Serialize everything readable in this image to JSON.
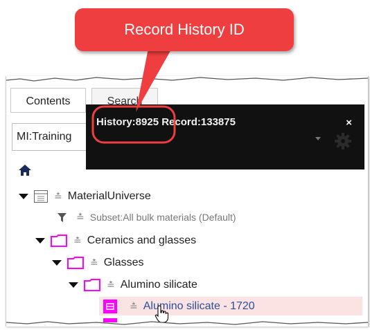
{
  "callout": {
    "text": "Record History ID",
    "color": "#ee3e3f"
  },
  "tabs": [
    {
      "label": "Contents",
      "active": true
    },
    {
      "label": "Search",
      "active": false
    }
  ],
  "database_select": {
    "value": "MI:Training"
  },
  "popup": {
    "text": "History:8925 Record:133875",
    "close_label": "×"
  },
  "tree": {
    "root": {
      "label": "MaterialUniverse"
    },
    "subset": {
      "label": "Subset:All bulk materials (Default)"
    },
    "items": [
      {
        "label": "Ceramics and glasses"
      },
      {
        "label": "Glasses"
      },
      {
        "label": "Alumino silicate"
      },
      {
        "label": "Alumino silicate - 1720",
        "selected": true
      }
    ]
  },
  "colors": {
    "folder": "#ff00ff",
    "selection": "#fbe3e4",
    "link": "#2a4d9b"
  },
  "icons": [
    "home-icon",
    "table-icon",
    "filter-icon",
    "folder-icon",
    "record-icon",
    "chevron-down-icon",
    "gear-icon",
    "hand-cursor-icon"
  ]
}
